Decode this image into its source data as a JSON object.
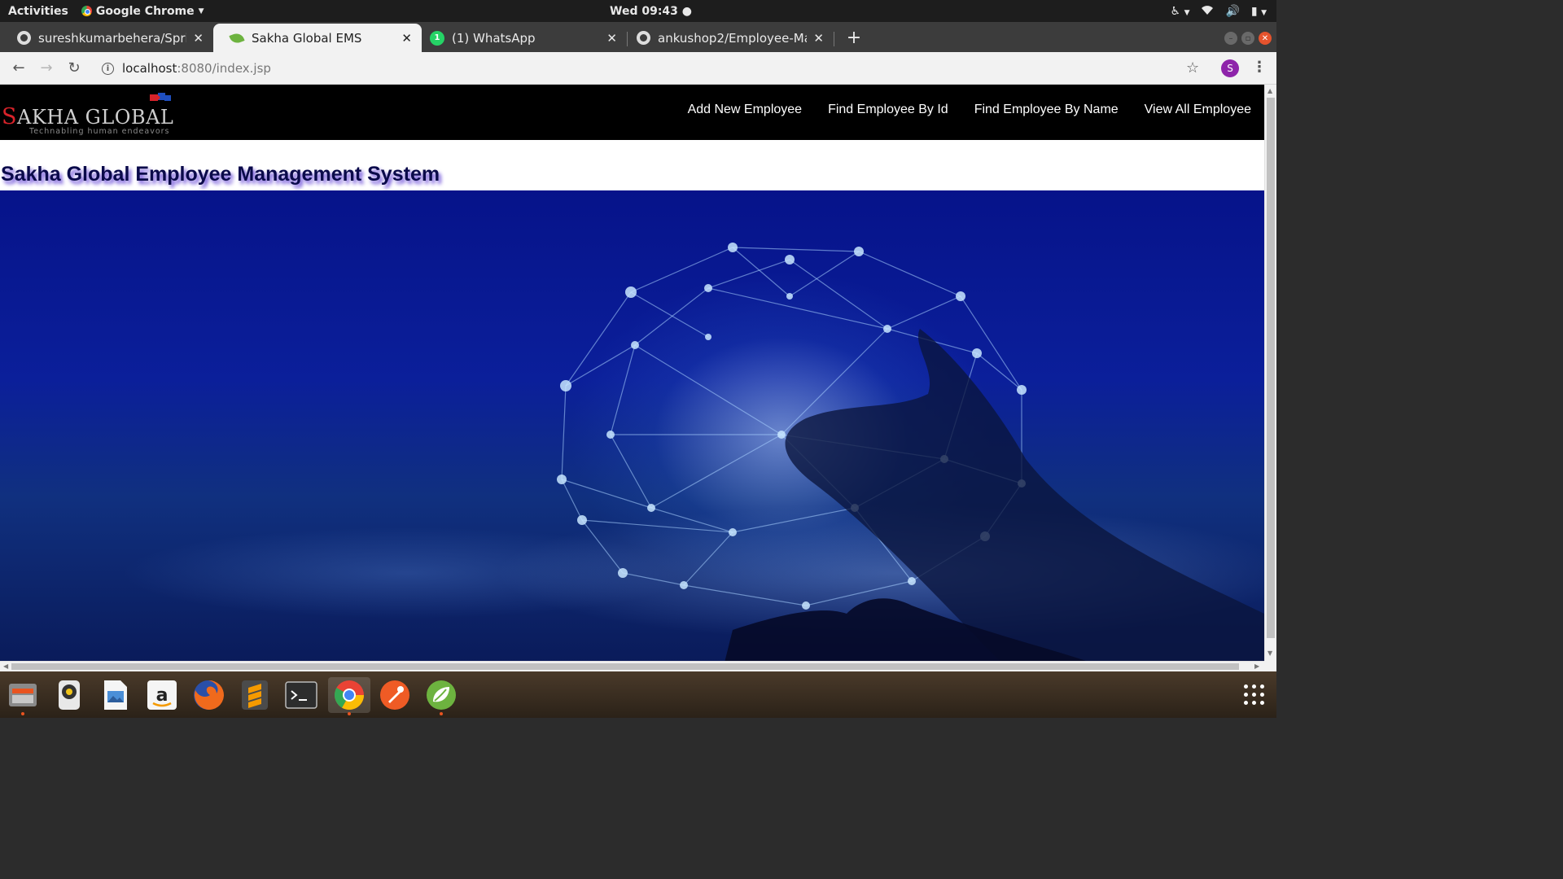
{
  "system_bar": {
    "activities": "Activities",
    "app_name": "Google Chrome",
    "clock": "Wed 09:43"
  },
  "tabs": [
    {
      "title": "sureshkumarbehera/Sprir",
      "icon": "github-icon"
    },
    {
      "title": "Sakha Global EMS",
      "icon": "spring-leaf-icon",
      "active": true
    },
    {
      "title": "(1) WhatsApp",
      "icon": "whatsapp-icon",
      "badge": "1"
    },
    {
      "title": "ankushop2/Employee-Ma",
      "icon": "github-icon"
    }
  ],
  "address_bar": {
    "host": "localhost",
    "path": ":8080/index.jsp"
  },
  "profile_initial": "S",
  "page": {
    "logo": {
      "first_letter": "S",
      "rest": "AKHA GLOBAL",
      "tagline": "Technabling human endeavors"
    },
    "nav": [
      "Add New Employee",
      "Find Employee By Id",
      "Find Employee By Name",
      "View All Employee"
    ],
    "title": "Sakha Global Employee Management System"
  },
  "dock": [
    "files-icon",
    "rhythmbox-icon",
    "image-viewer-icon",
    "amazon-icon",
    "firefox-icon",
    "sublime-text-icon",
    "terminal-icon",
    "chrome-icon",
    "postman-icon",
    "spring-tool-suite-icon"
  ],
  "colors": {
    "navbar_bg": "#000000",
    "logo_red": "#d8232a",
    "title_color": "#0a0a4a",
    "title_shadow": "#6a4bd8",
    "hero_blue": "#0b1f9a"
  }
}
